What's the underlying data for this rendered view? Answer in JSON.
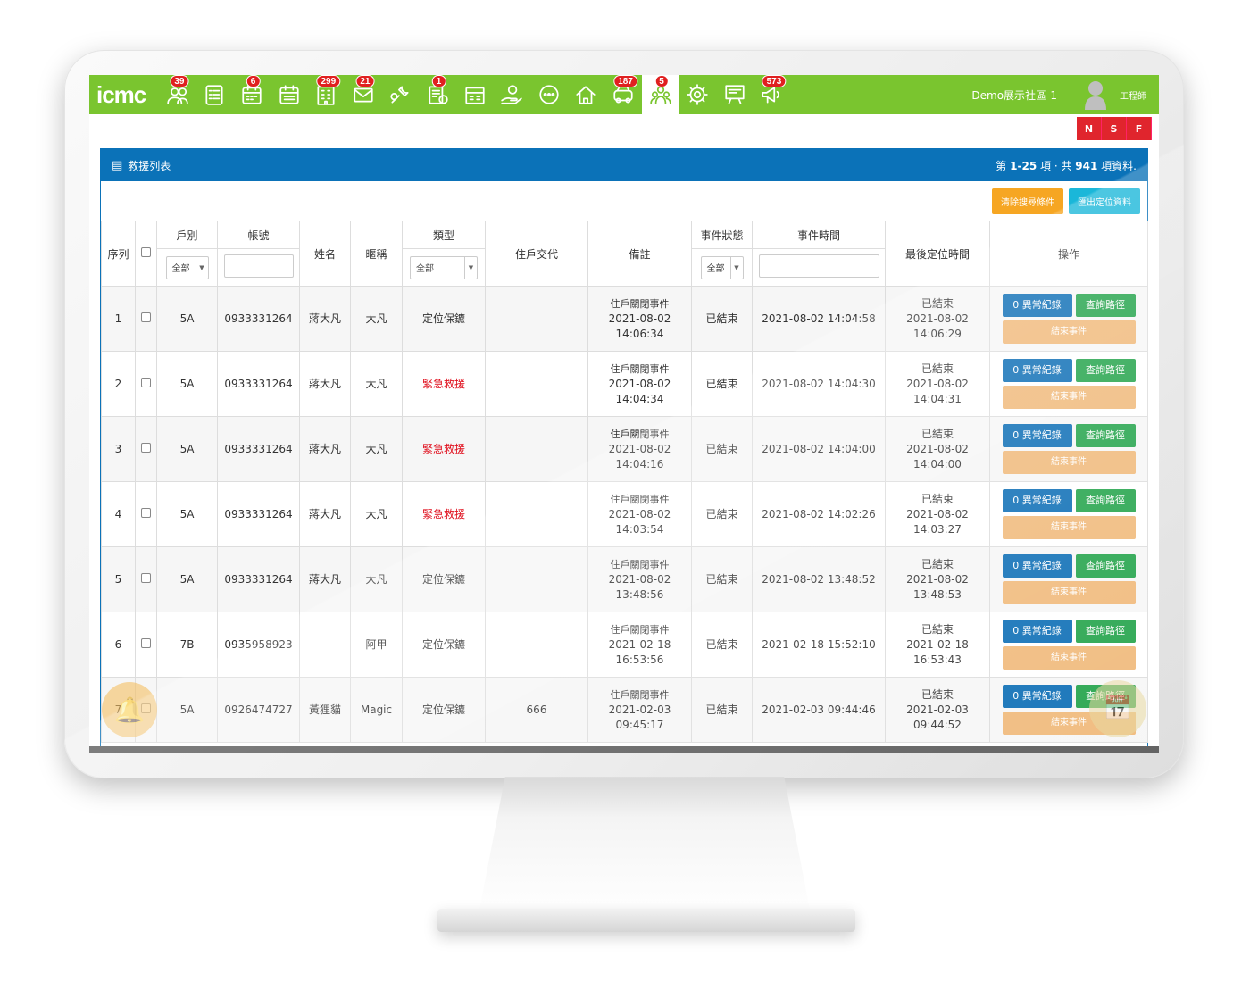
{
  "brand": {
    "logo": "icmc",
    "color": "#7ac52f"
  },
  "nav": {
    "icons": [
      {
        "name": "residents-icon",
        "badge": "39"
      },
      {
        "name": "checklist-icon",
        "badge": ""
      },
      {
        "name": "calendar-icon",
        "badge": "6"
      },
      {
        "name": "calendar-schedule-icon",
        "badge": ""
      },
      {
        "name": "building-icon",
        "badge": "299"
      },
      {
        "name": "mail-icon",
        "badge": "21"
      },
      {
        "name": "repair-icon",
        "badge": ""
      },
      {
        "name": "billing-icon",
        "badge": "1"
      },
      {
        "name": "fee-icon",
        "badge": ""
      },
      {
        "name": "hand-money-icon",
        "badge": ""
      },
      {
        "name": "chat-icon",
        "badge": ""
      },
      {
        "name": "home-guard-icon",
        "badge": ""
      },
      {
        "name": "parking-icon",
        "badge": "187"
      },
      {
        "name": "rescue-icon",
        "badge": "5"
      },
      {
        "name": "settings-icon",
        "badge": ""
      },
      {
        "name": "board-icon",
        "badge": ""
      },
      {
        "name": "announcement-icon",
        "badge": "573"
      }
    ],
    "community": "Demo展示社區-1",
    "role": "工程師",
    "quick": [
      "N",
      "S",
      "F"
    ]
  },
  "panel": {
    "title": "救援列表",
    "range_prefix": "第",
    "range": "1-25",
    "range_mid": "項 · 共",
    "total": "941",
    "range_suffix": "項資料.",
    "clear_button": "清除搜尋條件",
    "export_button": "匯出定位資料"
  },
  "table": {
    "headers": {
      "seq": "序列",
      "unit": "戶別",
      "account": "帳號",
      "name": "姓名",
      "nickname": "暱稱",
      "type": "類型",
      "resident_note": "住戶交代",
      "remark": "備註",
      "status": "事件狀態",
      "event_time": "事件時間",
      "last_location": "最後定位時間",
      "actions": "操作"
    },
    "filters": {
      "unit": "全部",
      "type": "全部",
      "status": "全部"
    },
    "rows": [
      {
        "seq": "1",
        "unit": "5A",
        "account": "0933331264",
        "name": "蔣大凡",
        "nickname": "大凡",
        "type": "定位保鑣",
        "type_color": "#333333",
        "resident_note": "",
        "remark_1": "住戶關閉事件",
        "remark_2": "2021-08-02",
        "remark_3": "14:06:34",
        "status": "已結束",
        "event_time": "2021-08-02 14:04:58",
        "last_1": "已結束",
        "last_2": "2021-08-02",
        "last_3": "14:06:29"
      },
      {
        "seq": "2",
        "unit": "5A",
        "account": "0933331264",
        "name": "蔣大凡",
        "nickname": "大凡",
        "type": "緊急救援",
        "type_color": "#e0101e",
        "resident_note": "",
        "remark_1": "住戶關閉事件",
        "remark_2": "2021-08-02",
        "remark_3": "14:04:34",
        "status": "已結束",
        "event_time": "2021-08-02 14:04:30",
        "last_1": "已結束",
        "last_2": "2021-08-02",
        "last_3": "14:04:31"
      },
      {
        "seq": "3",
        "unit": "5A",
        "account": "0933331264",
        "name": "蔣大凡",
        "nickname": "大凡",
        "type": "緊急救援",
        "type_color": "#e0101e",
        "resident_note": "",
        "remark_1": "住戶關閉事件",
        "remark_2": "2021-08-02",
        "remark_3": "14:04:16",
        "status": "已結束",
        "event_time": "2021-08-02 14:04:00",
        "last_1": "已結束",
        "last_2": "2021-08-02",
        "last_3": "14:04:00"
      },
      {
        "seq": "4",
        "unit": "5A",
        "account": "0933331264",
        "name": "蔣大凡",
        "nickname": "大凡",
        "type": "緊急救援",
        "type_color": "#e0101e",
        "resident_note": "",
        "remark_1": "住戶關閉事件",
        "remark_2": "2021-08-02",
        "remark_3": "14:03:54",
        "status": "已結束",
        "event_time": "2021-08-02 14:02:26",
        "last_1": "已結束",
        "last_2": "2021-08-02",
        "last_3": "14:03:27"
      },
      {
        "seq": "5",
        "unit": "5A",
        "account": "0933331264",
        "name": "蔣大凡",
        "nickname": "大凡",
        "type": "定位保鑣",
        "type_color": "#333333",
        "resident_note": "",
        "remark_1": "住戶關閉事件",
        "remark_2": "2021-08-02",
        "remark_3": "13:48:56",
        "status": "已結束",
        "event_time": "2021-08-02 13:48:52",
        "last_1": "已結束",
        "last_2": "2021-08-02",
        "last_3": "13:48:53"
      },
      {
        "seq": "6",
        "unit": "7B",
        "account": "0935958923",
        "name": "",
        "nickname": "阿甲",
        "type": "定位保鑣",
        "type_color": "#333333",
        "resident_note": "",
        "remark_1": "住戶關閉事件",
        "remark_2": "2021-02-18",
        "remark_3": "16:53:56",
        "status": "已結束",
        "event_time": "2021-02-18 15:52:10",
        "last_1": "已結束",
        "last_2": "2021-02-18",
        "last_3": "16:53:43"
      },
      {
        "seq": "7",
        "unit": "5A",
        "account": "0926474727",
        "name": "黃狸貓",
        "nickname": "Magic",
        "type": "定位保鑣",
        "type_color": "#333333",
        "resident_note": "666",
        "remark_1": "住戶關閉事件",
        "remark_2": "2021-02-03",
        "remark_3": "09:45:17",
        "status": "已結束",
        "event_time": "2021-02-03 09:44:46",
        "last_1": "已結束",
        "last_2": "2021-02-03",
        "last_3": "09:44:52"
      }
    ],
    "actions": {
      "anomaly": "0 異常紀錄",
      "route": "查詢路徑",
      "end": "結束事件"
    }
  },
  "colors": {
    "header_blue": "#0b72b8",
    "action_blue": "#0b6db5",
    "action_green": "#22a34a",
    "end_orange": "#f0b97a",
    "alert_red": "#e0101e",
    "clear_orange": "#f6a623",
    "export_cyan": "#1ab7d9"
  }
}
